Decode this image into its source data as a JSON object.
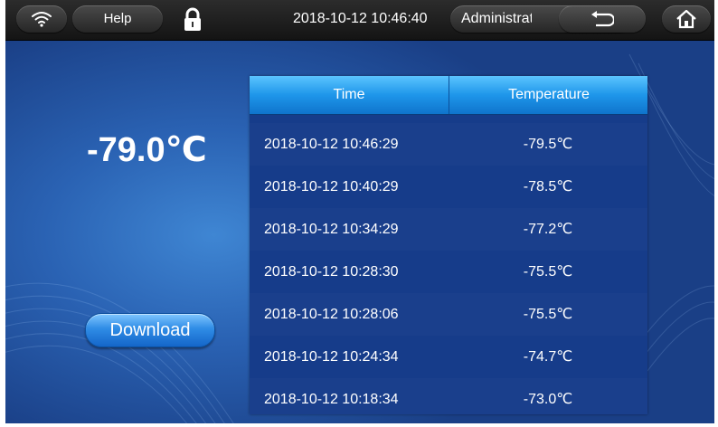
{
  "topbar": {
    "wifi_icon": "wifi-icon",
    "help_label": "Help",
    "lock_icon": "lock-icon",
    "datetime": "2018-10-12 10:46:40",
    "user": "Administrator",
    "back_icon": "back-arrow-icon",
    "home_icon": "home-icon"
  },
  "main": {
    "current_temperature": "-79.0℃",
    "download_label": "Download"
  },
  "table": {
    "columns": [
      "Time",
      "Temperature"
    ],
    "rows": [
      {
        "time": "2018-10-12 10:46:29",
        "temp": "-79.5℃"
      },
      {
        "time": "2018-10-12 10:40:29",
        "temp": "-78.5℃"
      },
      {
        "time": "2018-10-12 10:34:29",
        "temp": "-77.2℃"
      },
      {
        "time": "2018-10-12 10:28:30",
        "temp": "-75.5℃"
      },
      {
        "time": "2018-10-12 10:28:06",
        "temp": "-75.5℃"
      },
      {
        "time": "2018-10-12 10:24:34",
        "temp": "-74.7℃"
      },
      {
        "time": "2018-10-12 10:18:34",
        "temp": "-73.0℃"
      }
    ]
  },
  "colors": {
    "background": "#2a62b3",
    "topbar": "#1e1e1e",
    "table_header": "#1e96ea",
    "table_body": "#163c8a"
  }
}
